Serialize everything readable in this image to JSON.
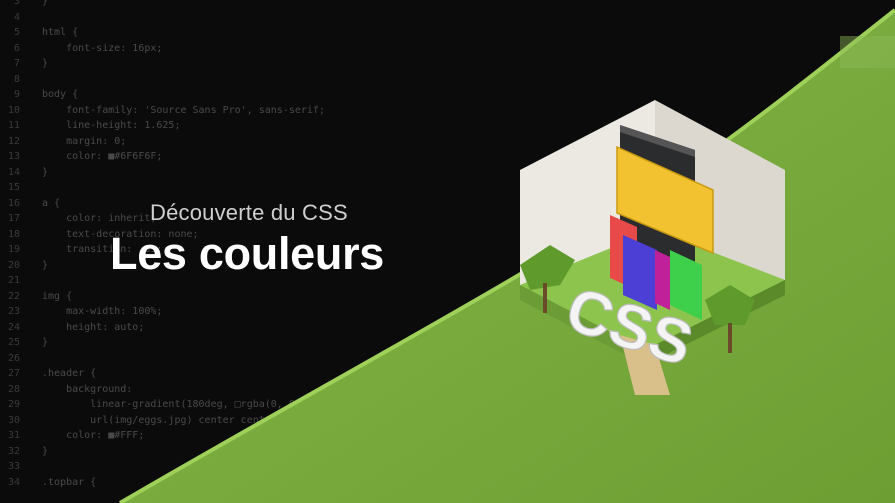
{
  "header": {
    "subtitle": "Découverte du CSS",
    "title": "Les couleurs"
  },
  "code_lines": [
    {
      "n": "3",
      "t": "}"
    },
    {
      "n": "4",
      "t": ""
    },
    {
      "n": "5",
      "t": "html {"
    },
    {
      "n": "6",
      "t": "    font-size: 16px;"
    },
    {
      "n": "7",
      "t": "}"
    },
    {
      "n": "8",
      "t": ""
    },
    {
      "n": "9",
      "t": "body {"
    },
    {
      "n": "10",
      "t": "    font-family: 'Source Sans Pro', sans-serif;"
    },
    {
      "n": "11",
      "t": "    line-height: 1.625;"
    },
    {
      "n": "12",
      "t": "    margin: 0;"
    },
    {
      "n": "13",
      "t": "    color: ■#6F6F6F;"
    },
    {
      "n": "14",
      "t": "}"
    },
    {
      "n": "15",
      "t": ""
    },
    {
      "n": "16",
      "t": "a {"
    },
    {
      "n": "17",
      "t": "    color: inherit;"
    },
    {
      "n": "18",
      "t": "    text-decoration: none;"
    },
    {
      "n": "19",
      "t": "    transition: .3s;"
    },
    {
      "n": "20",
      "t": "}"
    },
    {
      "n": "21",
      "t": ""
    },
    {
      "n": "22",
      "t": "img {"
    },
    {
      "n": "23",
      "t": "    max-width: 100%;"
    },
    {
      "n": "24",
      "t": "    height: auto;"
    },
    {
      "n": "25",
      "t": "}"
    },
    {
      "n": "26",
      "t": ""
    },
    {
      "n": "27",
      "t": ".header {"
    },
    {
      "n": "28",
      "t": "    background:"
    },
    {
      "n": "29",
      "t": "        linear-gradient(180deg, □rgba(0, 0"
    },
    {
      "n": "30",
      "t": "        url(img/eggs.jpg) center cente"
    },
    {
      "n": "31",
      "t": "    color: ■#FFF;"
    },
    {
      "n": "32",
      "t": "}"
    },
    {
      "n": "33",
      "t": ""
    },
    {
      "n": "34",
      "t": ".topbar {"
    }
  ],
  "illustration": {
    "caption_letters": "CSS"
  },
  "colors": {
    "background": "#0b0b0b",
    "green": "#7bab3b",
    "green_dark": "#6a9a30",
    "wall": "#e8e6e0",
    "yellow": "#f2c230",
    "red": "#e84a4a",
    "blue": "#4b3fd6",
    "lime": "#3ed04a",
    "magenta": "#c0209a"
  }
}
